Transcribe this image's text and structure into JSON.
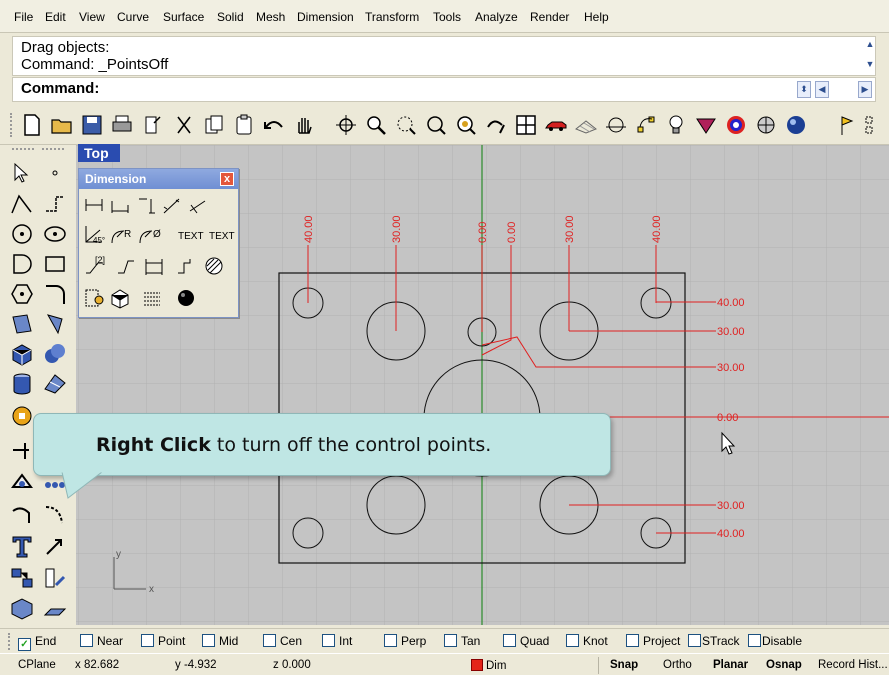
{
  "menu": [
    "File",
    "Edit",
    "View",
    "Curve",
    "Surface",
    "Solid",
    "Mesh",
    "Dimension",
    "Transform",
    "Tools",
    "Analyze",
    "Render",
    "Help"
  ],
  "command": {
    "history": [
      "Drag objects:",
      "Command: _PointsOff"
    ],
    "prompt_label": "Command:"
  },
  "viewport": {
    "title": "Top",
    "axis_x_label": "x",
    "axis_y_label": "y",
    "dimensions_top": [
      "40.00",
      "30.00",
      "0.00",
      "0.00",
      "30.00",
      "40.00"
    ],
    "dimensions_right": [
      "40.00",
      "30.00",
      "30.00",
      "0.00",
      "30.00",
      "40.00"
    ],
    "colors": {
      "background": "#c4c4c4",
      "grid": "#b3b3b3",
      "dimension": "#e02020",
      "y_axis": "#2c8c2c"
    }
  },
  "dimension_panel": {
    "title": "Dimension",
    "close": "x",
    "text_icon_1": "TEXT",
    "text_icon_2": "TEXT",
    "small_labels": [
      "R",
      "Ø",
      "45°",
      "[2]"
    ]
  },
  "callout": {
    "bold": "Right Click",
    "rest": " to turn off the control points."
  },
  "osnap": [
    {
      "label": "End",
      "checked": true
    },
    {
      "label": "Near",
      "checked": false
    },
    {
      "label": "Point",
      "checked": false
    },
    {
      "label": "Mid",
      "checked": false
    },
    {
      "label": "Cen",
      "checked": false
    },
    {
      "label": "Int",
      "checked": false
    },
    {
      "label": "Perp",
      "checked": false
    },
    {
      "label": "Tan",
      "checked": false
    },
    {
      "label": "Quad",
      "checked": false
    },
    {
      "label": "Knot",
      "checked": false
    },
    {
      "label": "Project",
      "checked": false
    },
    {
      "label": "STrack",
      "checked": false
    },
    {
      "label": "Disable",
      "checked": false
    }
  ],
  "status": {
    "cplane": "CPlane",
    "x": "x 82.682",
    "y": "y -4.932",
    "z": "z 0.000",
    "layer": "Dim",
    "layer_color": "#e4251a",
    "snap": "Snap",
    "ortho": "Ortho",
    "planar": "Planar",
    "osnap": "Osnap",
    "record": "Record Hist..."
  }
}
